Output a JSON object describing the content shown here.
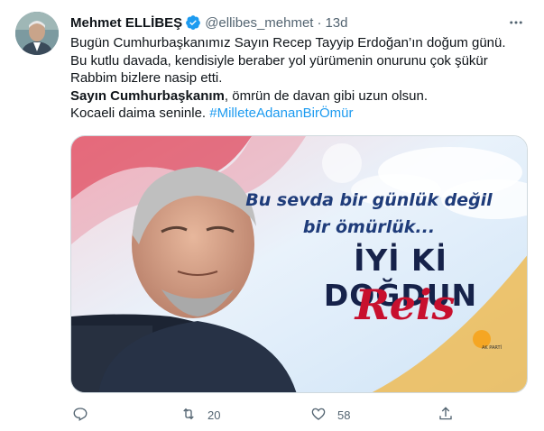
{
  "tweet": {
    "author_name": "Mehmet ELLİBEŞ",
    "handle": "@ellibes_mehmet",
    "separator": "·",
    "time": "13d",
    "lines": [
      "Bugün Cumhurbaşkanımız Sayın Recep Tayyip Erdoğan’ın doğum günü.",
      "Bu kutlu davada, kendisiyle beraber yol yürümenin onurunu çok şükür",
      "Rabbim bizlere nasip etti."
    ],
    "line4_bold": "Sayın Cumhurbaşkanım",
    "line4_rest": ", ömrün de davan gibi uzun olsun.",
    "line5_text": "Kocaeli daima seninle. ",
    "hashtag": "#MilleteAdananBirÖmür"
  },
  "media": {
    "line1": "Bu sevda bir günlük değil",
    "line2": "bir ömürlük...",
    "headline": "İYİ Kİ DOĞDUN",
    "signature": "Reis",
    "logo_text": "AK PARTİ"
  },
  "actions": {
    "reply_icon": "reply-icon",
    "retweet_icon": "retweet-icon",
    "retweet_count": "20",
    "like_icon": "heart-icon",
    "like_count": "58",
    "share_icon": "share-icon"
  },
  "colors": {
    "text": "#0f1419",
    "secondary": "#536471",
    "accent": "#1d9bf0"
  }
}
